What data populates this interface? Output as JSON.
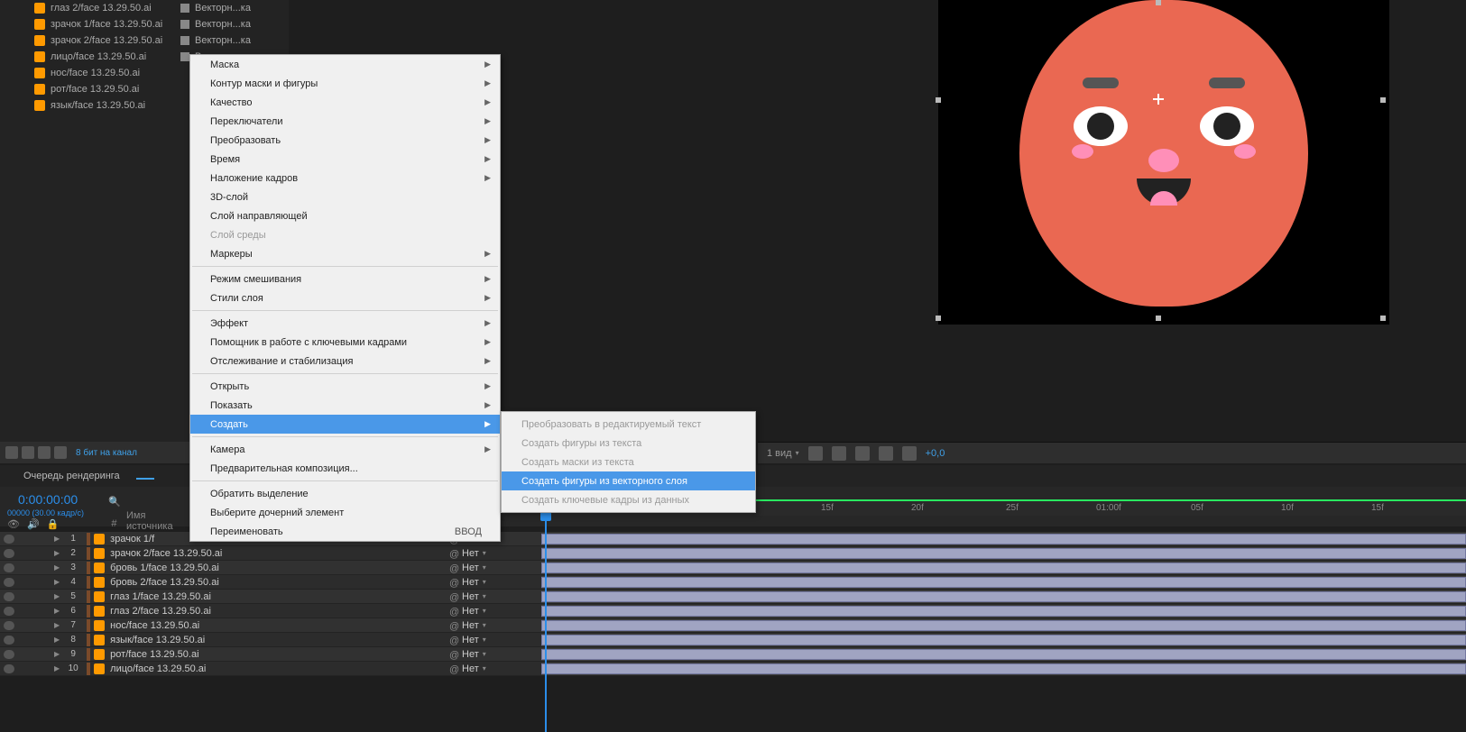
{
  "project": {
    "items": [
      {
        "name": "глаз 2/face 13.29.50.ai",
        "type": "Векторн...ка"
      },
      {
        "name": "зрачок 1/face 13.29.50.ai",
        "type": "Векторн...ка"
      },
      {
        "name": "зрачок 2/face 13.29.50.ai",
        "type": "Векторн...ка"
      },
      {
        "name": "лицо/face 13.29.50.ai",
        "type": "Векторн...ка"
      },
      {
        "name": "нос/face 13.29.50.ai",
        "type": ""
      },
      {
        "name": "рот/face 13.29.50.ai",
        "type": ""
      },
      {
        "name": "язык/face 13.29.50.ai",
        "type": ""
      }
    ]
  },
  "context_menu": {
    "items": [
      {
        "label": "Маска",
        "arrow": true
      },
      {
        "label": "Контур маски и фигуры",
        "arrow": true
      },
      {
        "label": "Качество",
        "arrow": true
      },
      {
        "label": "Переключатели",
        "arrow": true
      },
      {
        "label": "Преобразовать",
        "arrow": true
      },
      {
        "label": "Время",
        "arrow": true
      },
      {
        "label": "Наложение кадров",
        "arrow": true
      },
      {
        "label": "3D-слой"
      },
      {
        "label": "Слой направляющей"
      },
      {
        "label": "Слой среды",
        "disabled": true
      },
      {
        "label": "Маркеры",
        "arrow": true
      },
      {
        "sep": true
      },
      {
        "label": "Режим смешивания",
        "arrow": true
      },
      {
        "label": "Стили слоя",
        "arrow": true
      },
      {
        "sep": true
      },
      {
        "label": "Эффект",
        "arrow": true
      },
      {
        "label": "Помощник в работе с ключевыми кадрами",
        "arrow": true
      },
      {
        "label": "Отслеживание и стабилизация",
        "arrow": true
      },
      {
        "sep": true
      },
      {
        "label": "Открыть",
        "arrow": true
      },
      {
        "label": "Показать",
        "arrow": true
      },
      {
        "label": "Создать",
        "arrow": true,
        "highlighted": true
      },
      {
        "sep": true
      },
      {
        "label": "Камера",
        "arrow": true
      },
      {
        "label": "Предварительная композиция..."
      },
      {
        "sep": true
      },
      {
        "label": "Обратить выделение"
      },
      {
        "label": "Выберите дочерний элемент"
      },
      {
        "label": "Переименовать",
        "shortcut": "ВВОД"
      }
    ],
    "submenu": [
      {
        "label": "Преобразовать в редактируемый текст",
        "disabled": true
      },
      {
        "label": "Создать фигуры из текста",
        "disabled": true
      },
      {
        "label": "Создать маски из текста",
        "disabled": true
      },
      {
        "label": "Создать фигуры из векторного слоя",
        "highlighted": true
      },
      {
        "label": "Создать ключевые кадры из данных",
        "disabled": true
      }
    ]
  },
  "viewer_toolbar": {
    "view_count": "1 вид",
    "exposure": "+0,0"
  },
  "lower_bar": {
    "bpc": "8 бит на канал"
  },
  "tabs": {
    "render_queue": "Очередь рендеринга"
  },
  "timeline": {
    "timecode": "0:00:00:00",
    "framerate": "00000 (30.00 кадр/с)",
    "col_num": "#",
    "col_name": "Имя источника",
    "parent_none": "Нет",
    "ruler_labels": [
      "15f",
      "20f",
      "25f",
      "01:00f",
      "05f",
      "10f",
      "15f"
    ],
    "layers": [
      {
        "idx": 1,
        "name": "зрачок 1/f"
      },
      {
        "idx": 2,
        "name": "зрачок 2/face 13.29.50.ai"
      },
      {
        "idx": 3,
        "name": "бровь 1/face 13.29.50.ai"
      },
      {
        "idx": 4,
        "name": "бровь 2/face 13.29.50.ai"
      },
      {
        "idx": 5,
        "name": "глаз 1/face 13.29.50.ai"
      },
      {
        "idx": 6,
        "name": "глаз 2/face 13.29.50.ai"
      },
      {
        "idx": 7,
        "name": "нос/face 13.29.50.ai"
      },
      {
        "idx": 8,
        "name": "язык/face 13.29.50.ai"
      },
      {
        "idx": 9,
        "name": "рот/face 13.29.50.ai"
      },
      {
        "idx": 10,
        "name": "лицо/face 13.29.50.ai"
      }
    ]
  }
}
